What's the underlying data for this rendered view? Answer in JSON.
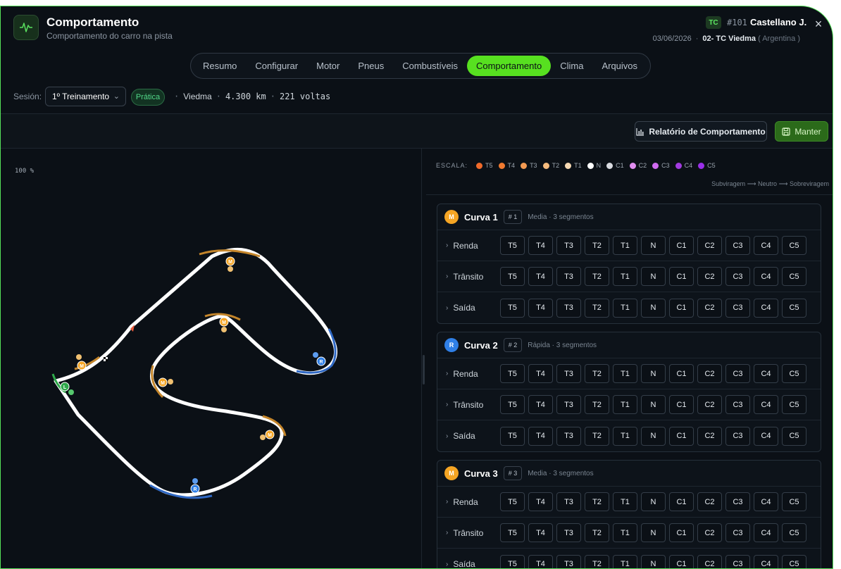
{
  "header": {
    "title": "Comportamento",
    "subtitle": "Comportamento do carro na pista",
    "category_badge": "TC",
    "car_number": "#101",
    "driver": "Castellano J.",
    "date": "03/06/2026",
    "event": "02- TC Viedma",
    "country": "( Argentina )"
  },
  "tabs": [
    "Resumo",
    "Configurar",
    "Motor",
    "Pneus",
    "Combustíveis",
    "Comportamento",
    "Clima",
    "Arquivos"
  ],
  "active_tab": "Comportamento",
  "session": {
    "label": "Sesión:",
    "selected": "1º Treinamento",
    "type_pill": "Prática",
    "track": "Viedma",
    "length": "4.300 km",
    "laps": "221 voltas"
  },
  "toolbar": {
    "report_button": "Relatório de Comportamento",
    "save_button": "Manter"
  },
  "track": {
    "zoom": "100 %"
  },
  "scale": {
    "label": "ESCALA:",
    "items": [
      {
        "code": "T5",
        "color": "#f06a2a"
      },
      {
        "code": "T4",
        "color": "#f07a30"
      },
      {
        "code": "T3",
        "color": "#f39a52"
      },
      {
        "code": "T2",
        "color": "#f5bb7e"
      },
      {
        "code": "T1",
        "color": "#f7d9b3"
      },
      {
        "code": "N",
        "color": "#ffffff"
      },
      {
        "code": "C1",
        "color": "#d9dbe0"
      },
      {
        "code": "C2",
        "color": "#e28ef0"
      },
      {
        "code": "C3",
        "color": "#d06af0"
      },
      {
        "code": "C4",
        "color": "#a23be0"
      },
      {
        "code": "C5",
        "color": "#9a2fe8"
      }
    ],
    "direction": "Subviragem ⟶ Neutro ⟶ Sobreviragem"
  },
  "rating_options": [
    "T5",
    "T4",
    "T3",
    "T2",
    "T1",
    "N",
    "C1",
    "C2",
    "C3",
    "C4",
    "C5"
  ],
  "curves": [
    {
      "badge": "M",
      "badge_color": "#f5a524",
      "name": "Curva 1",
      "num": "# 1",
      "desc": "Media · 3 segmentos",
      "segments": [
        "Renda",
        "Trânsito",
        "Saída"
      ]
    },
    {
      "badge": "R",
      "badge_color": "#2f7fe6",
      "name": "Curva 2",
      "num": "# 2",
      "desc": "Rápida · 3 segmentos",
      "segments": [
        "Renda",
        "Trânsito",
        "Saída"
      ]
    },
    {
      "badge": "M",
      "badge_color": "#f5a524",
      "name": "Curva 3",
      "num": "# 3",
      "desc": "Media · 3 segmentos",
      "segments": [
        "Renda",
        "Trânsito",
        "Saída"
      ]
    }
  ]
}
